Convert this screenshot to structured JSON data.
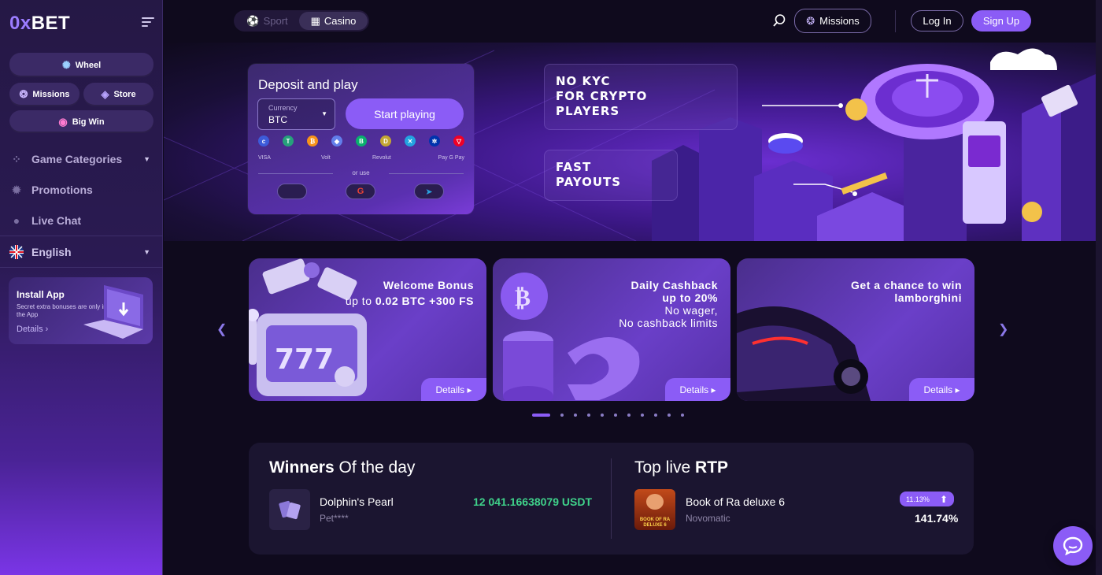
{
  "logo": {
    "text_a": "0x",
    "text_b": "BET"
  },
  "sidebar": {
    "quick": {
      "wheel": "Wheel",
      "missions": "Missions",
      "store": "Store",
      "big_win": "Big Win"
    },
    "nav": {
      "categories": "Game Categories",
      "promotions": "Promotions",
      "live_chat": "Live Chat",
      "language": "English"
    },
    "install": {
      "title": "Install App",
      "subtitle": "Secret extra bonuses are only in the App",
      "details": "Details"
    }
  },
  "topbar": {
    "tab_sport": "Sport",
    "tab_casino": "Casino",
    "missions": "Missions",
    "login": "Log In",
    "signup": "Sign Up"
  },
  "deposit": {
    "title": "Deposit and play",
    "currency_label": "Currency",
    "currency_value": "BTC",
    "start": "Start playing",
    "pay_visa": "VISA",
    "pay_volt": "Volt",
    "pay_revolut": "Revolut",
    "pay_wallets": "Pay G Pay",
    "or_use": "or use"
  },
  "hero": {
    "feature1": "NO KYC\nFOR CRYPTO\nPLAYERS",
    "feature2": "FAST\nPAYOUTS"
  },
  "promos": [
    {
      "line1": "Welcome Bonus",
      "line2": "up to",
      "line2b": "0.02 BTC +300 FS",
      "details": "Details"
    },
    {
      "line1": "Daily Cashback",
      "line2": "up to 20%",
      "line3": "No wager,",
      "line4": "No cashback limits",
      "details": "Details"
    },
    {
      "line1": "Get a chance to win",
      "line2": "lamborghini",
      "details": "Details"
    }
  ],
  "winners": {
    "title_bold": "Winners",
    "title_rest": "Of the day",
    "game": "Dolphin's Pearl",
    "user": "Pet****",
    "amount": "12 041.16638079 USDT"
  },
  "rtp": {
    "title_rest": "Top live",
    "title_bold": "RTP",
    "game": "Book of Ra deluxe 6",
    "provider": "Novomatic",
    "change": "11.13%",
    "value": "141.74%",
    "thumb_text": "BOOK OF RA DELUXE 6"
  },
  "colors": {
    "accent": "#8b5cf6",
    "win_green": "#3fd18a",
    "bg": "#0f0a1d"
  }
}
